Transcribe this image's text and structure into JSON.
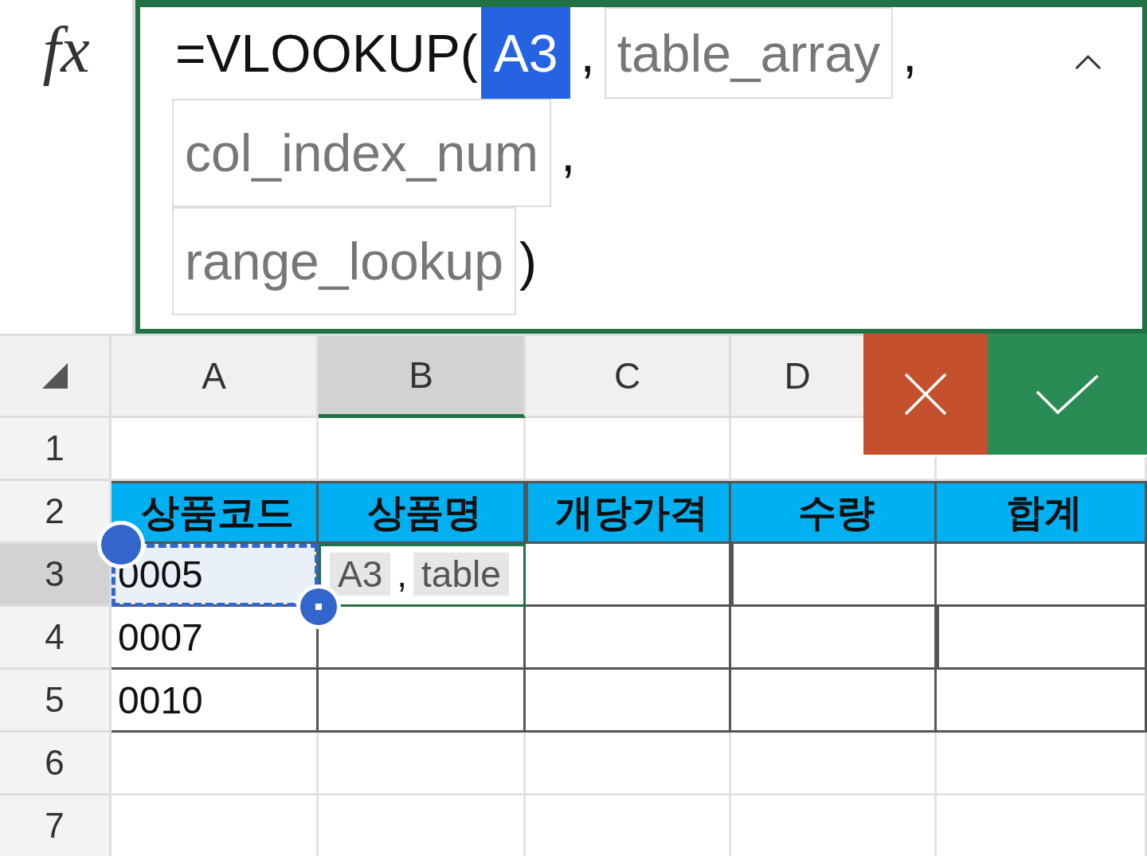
{
  "formula_bar": {
    "function_label": "fx",
    "lines": [
      [
        {
          "kind": "text",
          "text": "=VLOOKUP("
        },
        {
          "kind": "reference",
          "text": "A3"
        },
        {
          "kind": "separator",
          "text": ","
        },
        {
          "kind": "argument",
          "text": "table_array"
        },
        {
          "kind": "separator",
          "text": ","
        }
      ],
      [
        {
          "kind": "argument",
          "text": "col_index_num"
        },
        {
          "kind": "separator",
          "text": ","
        }
      ],
      [
        {
          "kind": "argument",
          "text": "range_lookup"
        },
        {
          "kind": "text",
          "text": ")"
        }
      ]
    ]
  },
  "columns": [
    {
      "label": "A",
      "selected": false
    },
    {
      "label": "B",
      "selected": true
    },
    {
      "label": "C",
      "selected": false
    },
    {
      "label": "D",
      "selected": false
    }
  ],
  "rows": [
    {
      "number": "1",
      "selected": false,
      "kind": "blank"
    },
    {
      "number": "2",
      "selected": false,
      "kind": "header",
      "cells": [
        {
          "text": "상품코드"
        },
        {
          "text": "상품명"
        },
        {
          "text": "개당가격"
        },
        {
          "text": "수량"
        },
        {
          "text": "합계"
        }
      ]
    },
    {
      "number": "3",
      "selected": true,
      "kind": "data",
      "cells": [
        {
          "text": "0005",
          "referenced": true
        }
      ],
      "editor": [
        {
          "kind": "argument",
          "text": "A3"
        },
        {
          "kind": "separator",
          "text": ","
        },
        {
          "kind": "argument",
          "text": "table"
        }
      ]
    },
    {
      "number": "4",
      "selected": false,
      "kind": "data",
      "cells": [
        {
          "text": "0007",
          "referenced": false
        }
      ]
    },
    {
      "number": "5",
      "selected": false,
      "kind": "data",
      "cells": [
        {
          "text": "0010",
          "referenced": false
        }
      ]
    },
    {
      "number": "6",
      "selected": false,
      "kind": "blank"
    },
    {
      "number": "7",
      "selected": false,
      "kind": "blank"
    }
  ]
}
